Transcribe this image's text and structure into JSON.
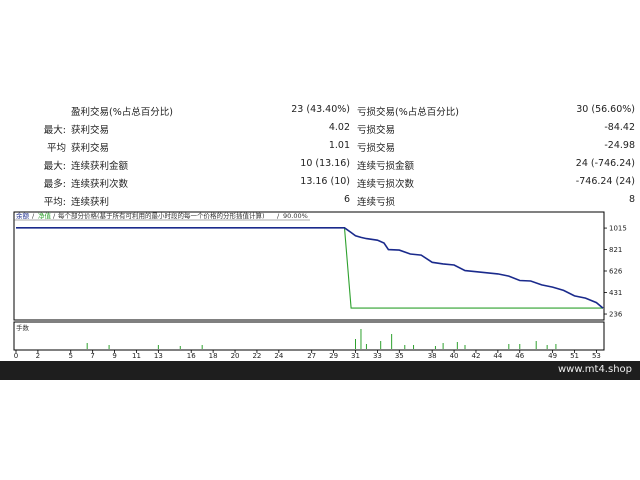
{
  "stats": {
    "rows": [
      {
        "p1": "",
        "l1": "盈利交易(%占总百分比)",
        "v1": "23 (43.40%)",
        "l2": "亏损交易(%占总百分比)",
        "v2": "30 (56.60%)"
      },
      {
        "p1": "最大:",
        "l1": "获利交易",
        "v1": "4.02",
        "l2": "亏损交易",
        "v2": "-84.42"
      },
      {
        "p1": "平均",
        "l1": "获利交易",
        "v1": "1.01",
        "l2": "亏损交易",
        "v2": "-24.98"
      },
      {
        "p1": "最大:",
        "l1": "连续获利金额",
        "v1": "10 (13.16)",
        "l2": "连续亏损金额",
        "v2": "24 (-746.24)"
      },
      {
        "p1": "最多:",
        "l1": "连续获利次数",
        "v1": "13.16 (10)",
        "l2": "连续亏损次数",
        "v2": "-746.24 (24)"
      },
      {
        "p1": "平均:",
        "l1": "连续获利",
        "v1": "6",
        "l2": "连续亏损",
        "v2": "8"
      }
    ]
  },
  "chart": {
    "legend_balance": "余额",
    "legend_sep1": "/",
    "legend_equity": "净值",
    "legend_sep2": "/",
    "legend_tail": "每个部分价格(基于所有可利用的最小时段的每一个价格的分形插值计算)",
    "legend_sep3": "/",
    "legend_pct": "90.00%",
    "volume_label": "手数",
    "colors": {
      "balance": "#1a2a8c",
      "equity": "#2ea12e",
      "volume": "#2ea12e"
    }
  },
  "chart_data": {
    "type": "line",
    "y_ticks": [
      1015,
      821,
      626,
      431,
      236
    ],
    "x_ticks": [
      0,
      2,
      5,
      7,
      9,
      11,
      13,
      16,
      18,
      20,
      22,
      24,
      27,
      29,
      31,
      33,
      35,
      38,
      40,
      42,
      44,
      46,
      49,
      51,
      53
    ],
    "xlim": [
      0,
      53.6
    ],
    "ylim": [
      200,
      1070
    ],
    "series": [
      {
        "key": "balance",
        "x": [
          0,
          29,
          30,
          30.6,
          31,
          31.5,
          32,
          33,
          33.6,
          34,
          35,
          36,
          37,
          38,
          39,
          40,
          41,
          42,
          43,
          44,
          45,
          46,
          47,
          48,
          49,
          50,
          51,
          52,
          53,
          53.6
        ],
        "y": [
          1017,
          1017,
          1017,
          975,
          945,
          930,
          920,
          905,
          880,
          820,
          815,
          780,
          770,
          705,
          690,
          680,
          630,
          620,
          610,
          600,
          580,
          540,
          535,
          500,
          480,
          450,
          400,
          380,
          340,
          290
        ]
      },
      {
        "key": "equity",
        "x": [
          0,
          29,
          30,
          30.6,
          53.6
        ],
        "y": [
          1017,
          1017,
          1017,
          290,
          290
        ]
      }
    ],
    "volume": {
      "x": [
        6.5,
        8.5,
        13,
        15,
        17,
        31,
        31.5,
        32,
        33.3,
        34.3,
        35.5,
        36.3,
        38.3,
        39,
        40.3,
        41,
        45,
        46,
        47.5,
        48.5,
        49.3
      ],
      "v": [
        0.6,
        0.4,
        0.4,
        0.3,
        0.4,
        1.0,
        2.0,
        0.5,
        0.8,
        1.5,
        0.4,
        0.4,
        0.3,
        0.6,
        0.7,
        0.4,
        0.5,
        0.5,
        0.8,
        0.4,
        0.5
      ]
    }
  },
  "footer": {
    "brand": "www.mt4.shop"
  }
}
